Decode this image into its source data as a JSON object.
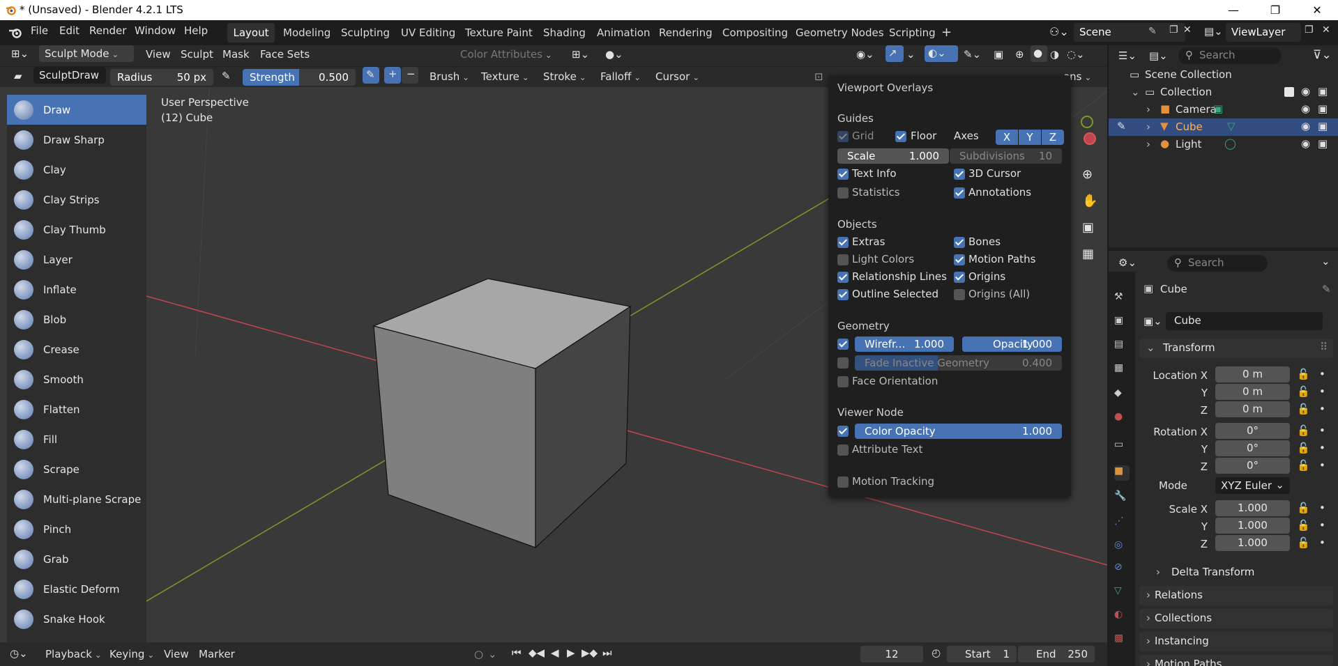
{
  "window": {
    "title": "* (Unsaved) - Blender 4.2.1 LTS",
    "minimize": "—",
    "maximize": "❐",
    "close": "✕"
  },
  "menubar": {
    "items": [
      "File",
      "Edit",
      "Render",
      "Window",
      "Help"
    ]
  },
  "workspaces": [
    "Layout",
    "Modeling",
    "Sculpting",
    "UV Editing",
    "Texture Paint",
    "Shading",
    "Animation",
    "Rendering",
    "Compositing",
    "Geometry Nodes",
    "Scripting"
  ],
  "workspace_add": "+",
  "scene": {
    "name": "Scene",
    "view_layer": "ViewLayer"
  },
  "header": {
    "mode": "Sculpt Mode",
    "menus": [
      "View",
      "Sculpt",
      "Mask",
      "Face Sets"
    ],
    "color_attributes": "Color Attributes"
  },
  "tool_settings": {
    "brush_name": "SculptDraw",
    "radius_label": "Radius",
    "radius_value": "50 px",
    "strength_label": "Strength",
    "strength_value": "0.500",
    "strength_fraction": 0.5,
    "plus": "+",
    "minus": "−",
    "dropdowns": [
      "Brush",
      "Texture",
      "Stroke",
      "Falloff",
      "Cursor"
    ],
    "options_partial": "ons"
  },
  "viewport": {
    "perspective": "User Perspective",
    "object_info": "(12) Cube"
  },
  "tools": [
    "Draw",
    "Draw Sharp",
    "Clay",
    "Clay Strips",
    "Clay Thumb",
    "Layer",
    "Inflate",
    "Blob",
    "Crease",
    "Smooth",
    "Flatten",
    "Fill",
    "Scrape",
    "Multi-plane Scrape",
    "Pinch",
    "Grab",
    "Elastic Deform",
    "Snake Hook"
  ],
  "overlays": {
    "title": "Viewport Overlays",
    "guides": {
      "heading": "Guides",
      "grid": "Grid",
      "floor": "Floor",
      "axes": "Axes",
      "axis_x": "X",
      "axis_y": "Y",
      "axis_z": "Z",
      "scale_label": "Scale",
      "scale_value": "1.000",
      "subdivisions_label": "Subdivisions",
      "subdivisions_value": "10",
      "text_info": "Text Info",
      "cursor_3d": "3D Cursor",
      "statistics": "Statistics",
      "annotations": "Annotations"
    },
    "objects": {
      "heading": "Objects",
      "extras": "Extras",
      "bones": "Bones",
      "light_colors": "Light Colors",
      "motion_paths": "Motion Paths",
      "relationship_lines": "Relationship Lines",
      "origins": "Origins",
      "outline_selected": "Outline Selected",
      "origins_all": "Origins (All)"
    },
    "geometry": {
      "heading": "Geometry",
      "wireframe_label": "Wirefr...",
      "wireframe_value": "1.000",
      "opacity_label": "Opacity",
      "opacity_value": "1.000",
      "fade_label": "Fade Inactive Geometry",
      "fade_value": "0.400",
      "face_orientation": "Face Orientation"
    },
    "viewer_node": {
      "heading": "Viewer Node",
      "color_opacity_label": "Color Opacity",
      "color_opacity_value": "1.000",
      "attribute_text": "Attribute Text"
    },
    "motion_tracking": "Motion Tracking"
  },
  "outliner": {
    "search_placeholder": "Search",
    "scene_collection": "Scene Collection",
    "collection": "Collection",
    "items": [
      "Camera",
      "Cube",
      "Light"
    ]
  },
  "properties": {
    "search_placeholder": "Search",
    "object_name": "Cube",
    "object_field": "Cube",
    "transform": "Transform",
    "location_x": "Location X",
    "axis_y": "Y",
    "axis_z": "Z",
    "loc_x": "0 m",
    "loc_y": "0 m",
    "loc_z": "0 m",
    "rotation_x": "Rotation X",
    "rot_x": "0°",
    "rot_y": "0°",
    "rot_z": "0°",
    "mode_label": "Mode",
    "mode_value": "XYZ Euler",
    "scale_x": "Scale X",
    "scl_x": "1.000",
    "scl_y": "1.000",
    "scl_z": "1.000",
    "panels": [
      "Delta Transform",
      "Relations",
      "Collections",
      "Instancing",
      "Motion Paths"
    ]
  },
  "timeline": {
    "playback": "Playback",
    "keying": "Keying",
    "view": "View",
    "marker": "Marker",
    "current_frame": "12",
    "start_label": "Start",
    "start_value": "1",
    "end_label": "End",
    "end_value": "250"
  },
  "colors": {
    "accent": "#4772b3",
    "viewport_bg": "#393939",
    "panel_bg": "#1f1f1f",
    "axis_red": "#c0454f",
    "axis_green": "#7c9a2a"
  }
}
